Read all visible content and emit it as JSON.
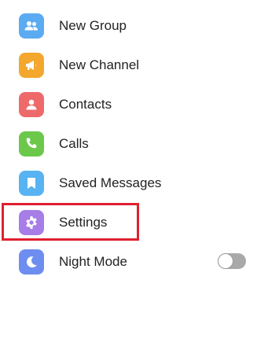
{
  "menu": {
    "items": [
      {
        "id": "new-group",
        "label": "New Group",
        "icon": "group-icon",
        "color": "#5aabf2"
      },
      {
        "id": "new-channel",
        "label": "New Channel",
        "icon": "megaphone-icon",
        "color": "#f3a72d"
      },
      {
        "id": "contacts",
        "label": "Contacts",
        "icon": "contact-icon",
        "color": "#ee6a6a"
      },
      {
        "id": "calls",
        "label": "Calls",
        "icon": "phone-icon",
        "color": "#6bc84a"
      },
      {
        "id": "saved-messages",
        "label": "Saved Messages",
        "icon": "bookmark-icon",
        "color": "#58b3f3"
      },
      {
        "id": "settings",
        "label": "Settings",
        "icon": "gear-icon",
        "color": "#a77de8"
      },
      {
        "id": "night-mode",
        "label": "Night Mode",
        "icon": "moon-icon",
        "color": "#6d8ef0"
      }
    ],
    "night_mode_enabled": false
  },
  "highlight": {
    "target": "settings",
    "color": "#e0202f"
  }
}
